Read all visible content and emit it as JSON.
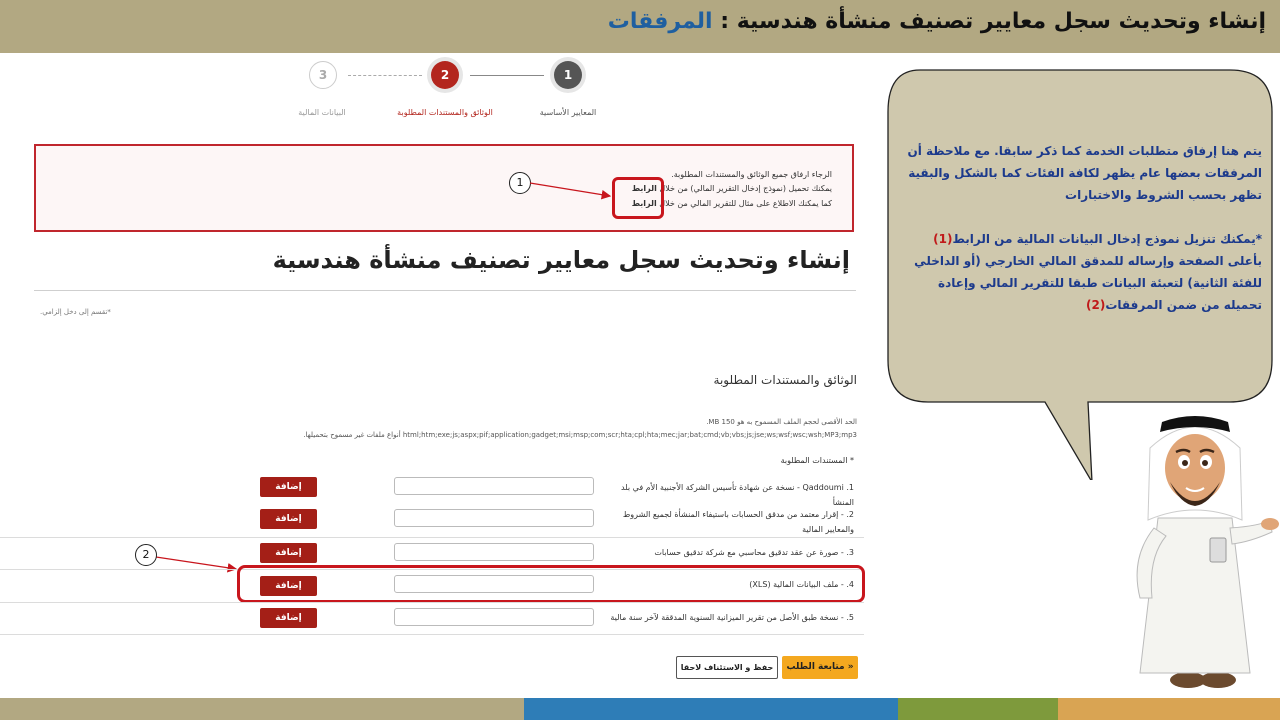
{
  "header": {
    "title_main": "إنشاء وتحديث سجل معايير تصنيف منشأة هندسية : ",
    "title_accent": "المرفقات"
  },
  "steps": [
    {
      "number": "3",
      "label": "البيانات المالية"
    },
    {
      "number": "2",
      "label": "الوثائق والمستندات المطلوبة"
    },
    {
      "number": "1",
      "label": "المعايير الأساسية"
    }
  ],
  "notice": {
    "line1": "الرجاء ارفاق جميع الوثائق والمستندات المطلوبة.",
    "line2_prefix": "يمكنك تحميل (نموذج إدخال التقرير المالي) من خلال ",
    "line2_link": "الرابط",
    "line3_prefix": "كما يمكنك الاطلاع على مثال للتقرير المالي من خلال ",
    "line3_link": "الرابط"
  },
  "page_title": "إنشاء وتحديث سجل معايير تصنيف منشأة هندسية",
  "required_hint": "*تقسم إلى دخل إلزامي.",
  "section_title": "الوثائق والمستندات المطلوبة",
  "file_limit_text": "الحد الأقصى لحجم الملف المسموح به هو 150 MB.",
  "file_types_text": "html;htm;exe;js;aspx;pif;application;gadget;msi;msp;com;scr;hta;cpl;hta;mec;jar;bat;cmd;vb;vbs;js;jse;ws;wsf;wsc;wsh;MP3;mp3 أنواع ملفات غير مسموح بتحميلها.",
  "required_docs_label": "* المستندات المطلوبة",
  "documents": [
    {
      "label": "1. Qaddoumi - نسخة عن شهادة تأسيس الشركة الأجنبية الأم في بلد المنشأ",
      "button": "إضافة"
    },
    {
      "label": "2. - إقرار معتمد من مدقق الحسابات باستيفاء المنشأة لجميع الشروط والمعايير المالية",
      "button": "إضافة"
    },
    {
      "label": "3. - صورة عن عقد تدقيق محاسبي مع شركة تدقيق حسابات",
      "button": "إضافة"
    },
    {
      "label": "4. - ملف البيانات المالية (XLS)",
      "button": "إضافة"
    },
    {
      "label": "5. - نسخة طبق الأصل من تقرير الميزانية السنوية المدققة لآخر سنة مالية",
      "button": "إضافة"
    }
  ],
  "buttons": {
    "continue": "متابعة الطلب »",
    "save": "حفظ و الاستئناف لاحقا"
  },
  "markers": {
    "one": "1",
    "two": "2"
  },
  "callout": {
    "para1": "يتم هنا إرفاق متطلبات الخدمة كما ذكر سابقا. مع ملاحظة أن المرفقات بعضها عام يظهر لكافة الفئات كما بالشكل والبقية تظهر بحسب الشروط والاختبارات",
    "para2_a": "*يمكنك تنزيل نموذج إدخال البيانات المالية من الرابط",
    "para2_num1": "(1)",
    "para2_b": " بأعلى الصفحة وإرساله للمدقق المالي الخارجي (أو الداخلي للفئة الثانية) لتعبئة البيانات طبقا للتقرير المالي وإعادة تحميله من ضمن المرفقات",
    "para2_num2": "(2)"
  },
  "colors": {
    "header_bg": "#b2a882",
    "accent_blue": "#1f5fa0",
    "button_red": "#a41f17",
    "highlight_red": "#c8161d",
    "continue_orange": "#f4a81f",
    "callout_bg": "#cfc8ad",
    "footer_tan": "#b2a882",
    "footer_blue": "#2e7db7",
    "footer_green": "#7e9a3c",
    "footer_orange": "#d9a453"
  }
}
